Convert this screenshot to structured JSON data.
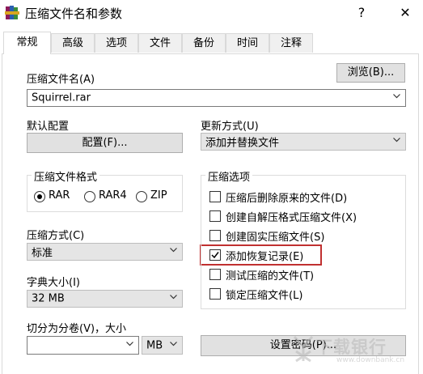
{
  "window": {
    "title": "压缩文件名和参数",
    "help_glyph": "?",
    "close_glyph": "✕",
    "icon": "winrar-books-icon"
  },
  "tabs": [
    "常规",
    "高级",
    "选项",
    "文件",
    "备份",
    "时间",
    "注释"
  ],
  "active_tab": "常规",
  "archive_name": {
    "label": "压缩文件名(A)",
    "browse_label": "浏览(B)...",
    "value": "Squirrel.rar"
  },
  "profiles": {
    "label": "默认配置",
    "button_label": "配置(F)..."
  },
  "update_mode": {
    "label": "更新方式(U)",
    "value": "添加并替换文件"
  },
  "archive_format": {
    "title": "压缩文件格式",
    "options": [
      "RAR",
      "RAR4",
      "ZIP"
    ],
    "selected": "RAR"
  },
  "compression_method": {
    "label": "压缩方式(C)",
    "value": "标准"
  },
  "dictionary_size": {
    "label": "字典大小(I)",
    "value": "32 MB"
  },
  "split_volumes": {
    "label": "切分为分卷(V)，大小",
    "value": "",
    "unit": "MB"
  },
  "archive_options": {
    "title": "压缩选项",
    "items": [
      {
        "label": "压缩后删除原来的文件(D)",
        "checked": false
      },
      {
        "label": "创建自解压格式压缩文件(X)",
        "checked": false
      },
      {
        "label": "创建固实压缩文件(S)",
        "checked": false
      },
      {
        "label": "添加恢复记录(E)",
        "checked": true
      },
      {
        "label": "测试压缩的文件(T)",
        "checked": false
      },
      {
        "label": "锁定压缩文件(L)",
        "checked": false
      }
    ]
  },
  "set_password": {
    "label": "设置密码(P)..."
  },
  "watermark": {
    "text": "下载银行",
    "url": "www.downbank.cn"
  },
  "colors": {
    "highlight": "#c03030",
    "button_bg": "#e1e1e1",
    "tab_inactive": "#f0f0f0"
  }
}
